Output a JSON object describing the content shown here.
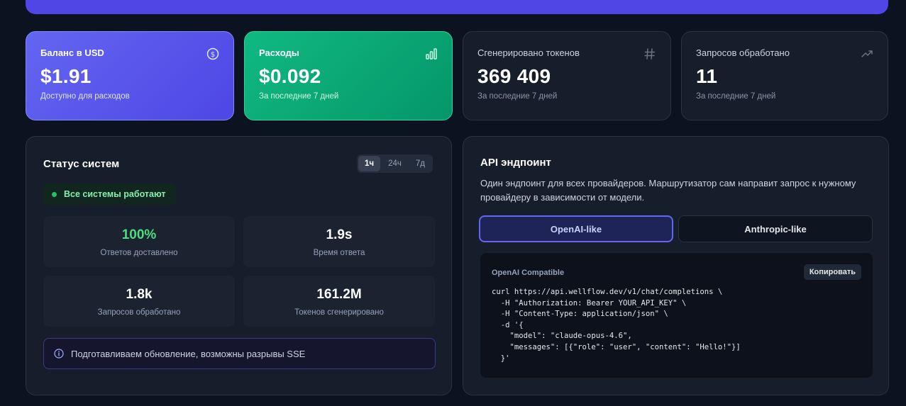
{
  "stats": [
    {
      "label": "Баланс в USD",
      "value": "$1.91",
      "sub": "Доступно для расходов",
      "icon": "dollar-circle-icon"
    },
    {
      "label": "Расходы",
      "value": "$0.092",
      "sub": "За последние 7 дней",
      "icon": "bar-chart-icon"
    },
    {
      "label": "Сгенерировано токенов",
      "value": "369 409",
      "sub": "За последние 7 дней",
      "icon": "hash-icon"
    },
    {
      "label": "Запросов обработано",
      "value": "11",
      "sub": "За последние 7 дней",
      "icon": "trending-up-icon"
    }
  ],
  "status": {
    "title": "Статус систем",
    "ranges": [
      "1ч",
      "24ч",
      "7д"
    ],
    "active_range": "1ч",
    "ok_text": "Все системы работают",
    "metrics": [
      {
        "value": "100%",
        "label": "Ответов доставлено"
      },
      {
        "value": "1.9s",
        "label": "Время ответа"
      },
      {
        "value": "1.8k",
        "label": "Запросов обработано"
      },
      {
        "value": "161.2M",
        "label": "Токенов сгенерировано"
      }
    ],
    "notice": "Подготавливаем обновление, возможны разрывы SSE"
  },
  "api": {
    "title": "API эндпоинт",
    "description": "Один эндпоинт для всех провайдеров. Маршрутизатор сам направит запрос к нужному провайдеру в зависимости от модели.",
    "tabs": [
      "OpenAI-like",
      "Anthropic-like"
    ],
    "active_tab": "OpenAI-like",
    "code_header": "OpenAI Compatible",
    "copy_label": "Копировать",
    "code": "curl https://api.wellflow.dev/v1/chat/completions \\\n  -H \"Authorization: Bearer YOUR_API_KEY\" \\\n  -H \"Content-Type: application/json\" \\\n  -d '{\n    \"model\": \"claude-opus-4.6\",\n    \"messages\": [{\"role\": \"user\", \"content\": \"Hello!\"}]\n  }'"
  },
  "colors": {
    "accent": "#6366f1",
    "success": "#10b981",
    "background": "#0b1220",
    "card": "#161e2b"
  }
}
